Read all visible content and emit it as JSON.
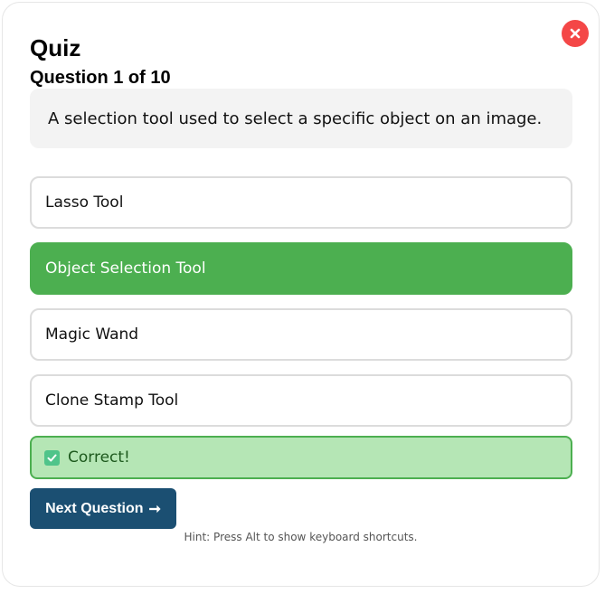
{
  "quiz": {
    "title": "Quiz",
    "progress": "Question 1 of 10",
    "question": "A selection tool used to select a specific object on an image.",
    "options": [
      {
        "label": "Lasso Tool",
        "selected": false
      },
      {
        "label": "Object Selection Tool",
        "selected": true
      },
      {
        "label": "Magic Wand",
        "selected": false
      },
      {
        "label": "Clone Stamp Tool",
        "selected": false
      }
    ],
    "feedback": "Correct!",
    "next_label": "Next Question",
    "next_arrow": "➞",
    "hint": "Hint: Press Alt to show keyboard shortcuts."
  },
  "icons": {
    "close": "close-icon",
    "feedback": "check-icon",
    "next": "arrow-right-icon"
  },
  "colors": {
    "close": "#f44747",
    "selected_option": "#4caf50",
    "feedback_bg": "#b5e6b5",
    "feedback_border": "#4caf50",
    "next_button": "#1b4f72"
  }
}
